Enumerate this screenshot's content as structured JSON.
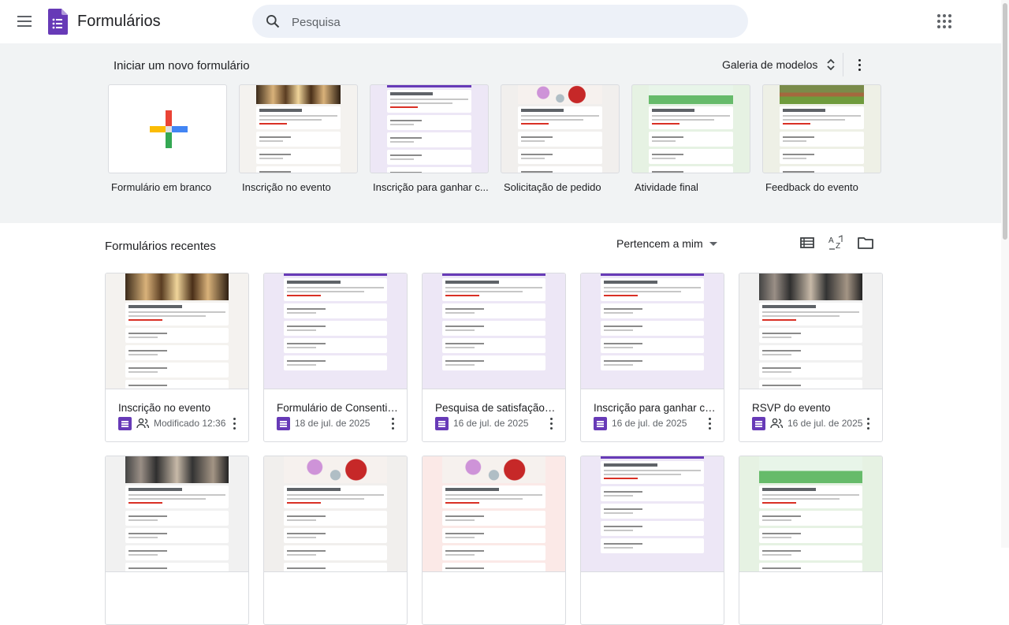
{
  "header": {
    "app_title": "Formulários",
    "search_placeholder": "Pesquisa"
  },
  "templates": {
    "heading": "Iniciar um novo formulário",
    "gallery_label": "Galeria de modelos",
    "items": [
      {
        "label": "Formulário em branco",
        "kind": "blank"
      },
      {
        "label": "Inscrição no evento",
        "kind": "hall",
        "bg": "#f4f2ef"
      },
      {
        "label": "Inscrição para ganhar c...",
        "kind": "plain",
        "bg": "#ede7f6",
        "accent": "#673ab7"
      },
      {
        "label": "Solicitação de pedido",
        "kind": "flowers",
        "bg": "#f1efed"
      },
      {
        "label": "Atividade final",
        "kind": "green",
        "bg": "#e6f2e3"
      },
      {
        "label": "Feedback do evento",
        "kind": "garden",
        "bg": "#eef0e6"
      }
    ]
  },
  "recent": {
    "heading": "Formulários recentes",
    "owner_filter": "Pertencem a mim",
    "docs": [
      {
        "title": "Inscrição no evento",
        "meta": "Modificado 12:36",
        "shared": true,
        "kind": "hall",
        "bg": "#f4f2ef"
      },
      {
        "title": "Formulário de Consentim...",
        "meta": "18 de jul. de 2025",
        "shared": false,
        "kind": "plain",
        "bg": "#ede7f6",
        "accent": "#673ab7"
      },
      {
        "title": "Pesquisa de satisfação do...",
        "meta": "16 de jul. de 2025",
        "shared": false,
        "kind": "plain",
        "bg": "#ede7f6",
        "accent": "#673ab7"
      },
      {
        "title": "Inscrição para ganhar ca...",
        "meta": "16 de jul. de 2025",
        "shared": false,
        "kind": "plain",
        "bg": "#ede7f6",
        "accent": "#673ab7"
      },
      {
        "title": "RSVP do evento",
        "meta": "16 de jul. de 2025",
        "shared": true,
        "kind": "crowd",
        "bg": "#f1f1f1"
      },
      {
        "title": "",
        "meta": "",
        "shared": false,
        "kind": "crowd",
        "bg": "#f1f1f1"
      },
      {
        "title": "",
        "meta": "",
        "shared": false,
        "kind": "flowers",
        "bg": "#f1efed"
      },
      {
        "title": "",
        "meta": "",
        "shared": false,
        "kind": "flowers",
        "bg": "#fbe9e7"
      },
      {
        "title": "",
        "meta": "",
        "shared": false,
        "kind": "plain",
        "bg": "#ede7f6",
        "accent": "#673ab7"
      },
      {
        "title": "",
        "meta": "",
        "shared": false,
        "kind": "green",
        "bg": "#e6f2e3"
      }
    ]
  },
  "colors": {
    "forms_purple": "#673ab7",
    "template_bg": "#f1f3f4",
    "search_bg": "#edf1f8"
  },
  "icons": [
    "menu-icon",
    "forms-logo-icon",
    "search-icon",
    "apps-grid-icon",
    "unfold-icon",
    "more-vert-icon",
    "list-view-icon",
    "sort-az-icon",
    "folder-icon",
    "shared-people-icon",
    "google-plus-icon"
  ]
}
